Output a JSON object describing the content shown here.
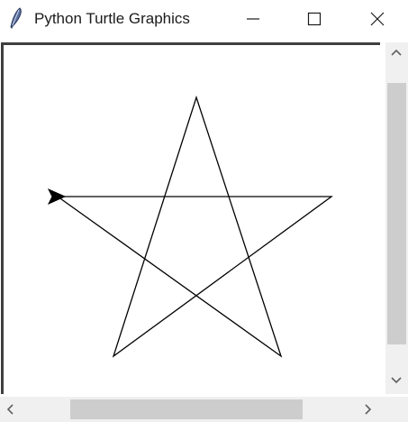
{
  "window": {
    "title": "Python Turtle Graphics",
    "icon": "feather-icon",
    "controls": [
      "minimize-icon",
      "maximize-icon",
      "close-icon"
    ]
  },
  "canvas": {
    "background": "#ffffff",
    "pen_color": "#000000",
    "turtle_shape": "arrow",
    "turtle_heading": "east",
    "figure": "five-pointed star"
  },
  "scrollbars": {
    "vertical": {
      "icons": [
        "chevron-up-icon",
        "chevron-down-icon"
      ]
    },
    "horizontal": {
      "icons": [
        "chevron-left-icon",
        "chevron-right-icon"
      ]
    }
  }
}
